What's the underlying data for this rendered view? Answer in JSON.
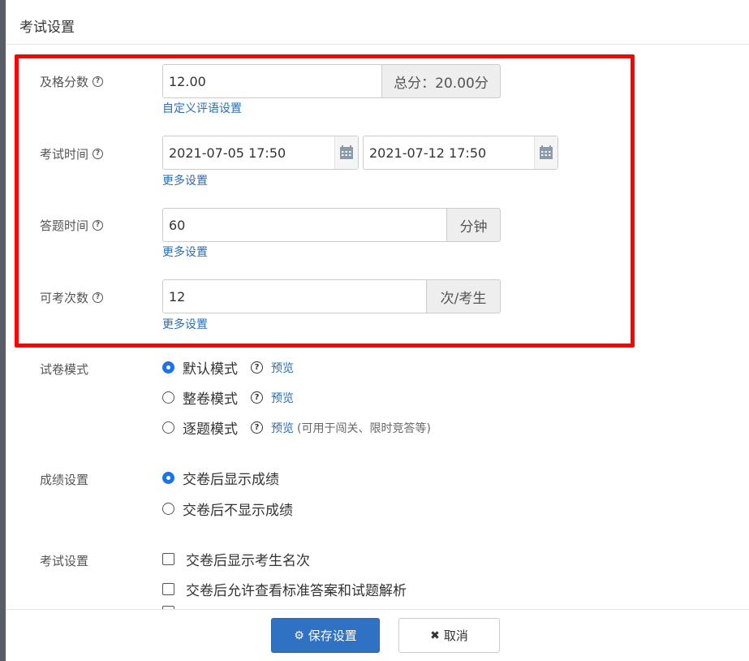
{
  "modal": {
    "title": "考试设置"
  },
  "fields": {
    "pass_score": {
      "label": "及格分数",
      "value": "12.00",
      "addon": "总分：20.00分",
      "link": "自定义评语设置"
    },
    "exam_time": {
      "label": "考试时间",
      "start": "2021-07-05 17:50",
      "end": "2021-07-12 17:50",
      "link": "更多设置"
    },
    "answer_time": {
      "label": "答题时间",
      "value": "60",
      "addon": "分钟",
      "link": "更多设置"
    },
    "attempts": {
      "label": "可考次数",
      "value": "12",
      "addon": "次/考生",
      "link": "更多设置"
    }
  },
  "paper_mode": {
    "label": "试卷模式",
    "options": [
      {
        "label": "默认模式",
        "checked": true,
        "preview": "预览",
        "note": ""
      },
      {
        "label": "整卷模式",
        "checked": false,
        "preview": "预览",
        "note": ""
      },
      {
        "label": "逐题模式",
        "checked": false,
        "preview": "预览",
        "note": "(可用于闯关、限时竞答等)"
      }
    ]
  },
  "score_setting": {
    "label": "成绩设置",
    "options": [
      {
        "label": "交卷后显示成绩",
        "checked": true
      },
      {
        "label": "交卷后不显示成绩",
        "checked": false
      }
    ]
  },
  "exam_setting": {
    "label": "考试设置",
    "options": [
      {
        "label": "交卷后显示考生名次",
        "checked": false
      },
      {
        "label": "交卷后允许查看标准答案和试题解析",
        "checked": false
      }
    ]
  },
  "footer": {
    "save": "保存设置",
    "cancel": "取消"
  },
  "colors": {
    "primary": "#2f72c4",
    "link": "#2a6db5",
    "highlight": "#ff0000"
  },
  "icons": {
    "help": "question-circle-icon",
    "calendar": "calendar-icon",
    "save": "gear-icon",
    "cancel": "close-icon"
  }
}
